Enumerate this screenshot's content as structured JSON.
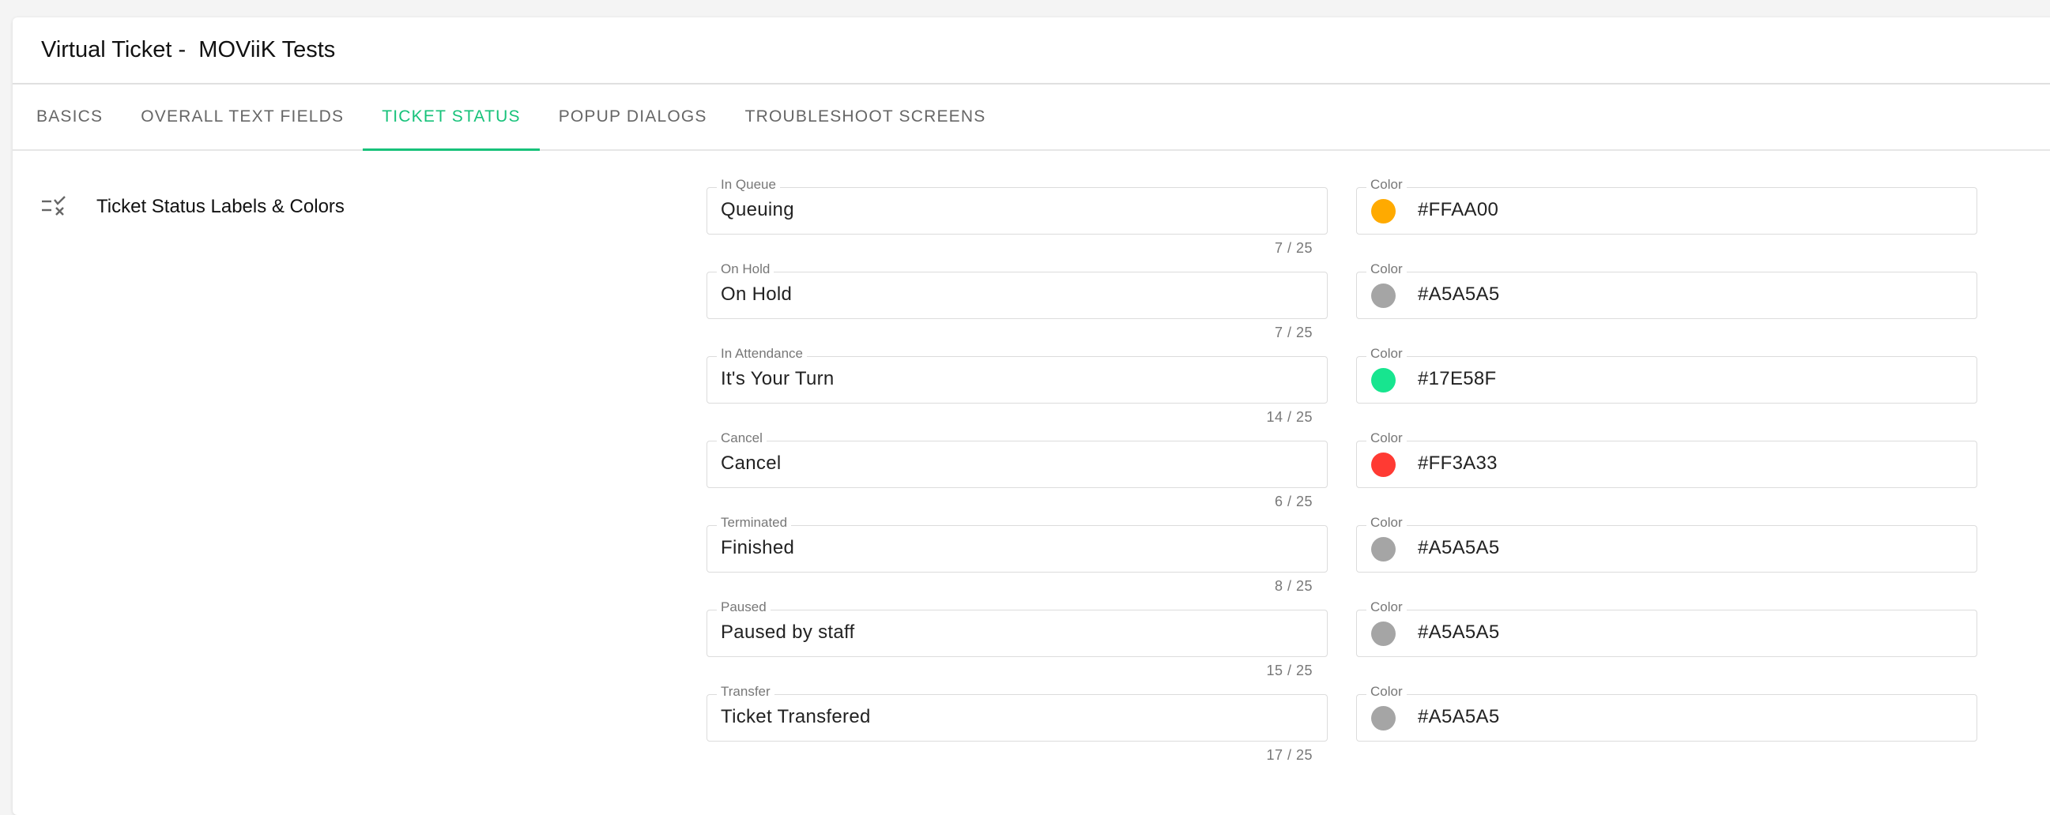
{
  "header": {
    "title": "Virtual Ticket -  MOViiK Tests"
  },
  "tabs": [
    {
      "label": "BASICS"
    },
    {
      "label": "OVERALL TEXT FIELDS"
    },
    {
      "label": "TICKET STATUS",
      "active": true
    },
    {
      "label": "POPUP DIALOGS"
    },
    {
      "label": "TROUBLESHOOT SCREENS"
    }
  ],
  "section": {
    "title": "Ticket Status Labels & Colors",
    "icon": "checklist-icon"
  },
  "statuses": [
    {
      "label": "In Queue",
      "value": "Queuing",
      "counter": "7 / 25",
      "color_label": "Color",
      "color": "#FFAA00"
    },
    {
      "label": "On Hold",
      "value": "On Hold",
      "counter": "7 / 25",
      "color_label": "Color",
      "color": "#A5A5A5"
    },
    {
      "label": "In Attendance",
      "value": "It's Your Turn",
      "counter": "14 / 25",
      "color_label": "Color",
      "color": "#17E58F"
    },
    {
      "label": "Cancel",
      "value": "Cancel",
      "counter": "6 / 25",
      "color_label": "Color",
      "color": "#FF3A33"
    },
    {
      "label": "Terminated",
      "value": "Finished",
      "counter": "8 / 25",
      "color_label": "Color",
      "color": "#A5A5A5"
    },
    {
      "label": "Paused",
      "value": "Paused by staff",
      "counter": "15 / 25",
      "color_label": "Color",
      "color": "#A5A5A5"
    },
    {
      "label": "Transfer",
      "value": "Ticket Transfered",
      "counter": "17 / 25",
      "color_label": "Color",
      "color": "#A5A5A5"
    }
  ],
  "colors": {
    "accent": "#17C27A"
  }
}
